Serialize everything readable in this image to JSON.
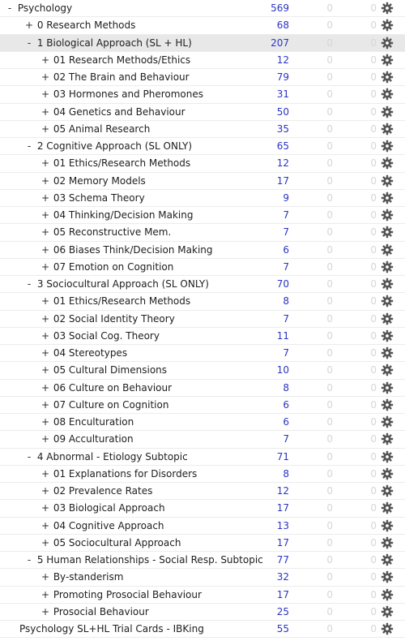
{
  "colors": {
    "new_count": "#2a35c4",
    "zero_count": "#d6d6d6",
    "current_row": "#e8e8e8",
    "gear": "#555555"
  },
  "icons": {
    "gear": "gear-icon"
  },
  "decks": [
    {
      "toggle": "-",
      "name": "Psychology",
      "new": "569",
      "learn": "0",
      "due": "0",
      "level": 0
    },
    {
      "toggle": "+",
      "name": "0 Research Methods",
      "new": "68",
      "learn": "0",
      "due": "0",
      "level": 1
    },
    {
      "toggle": "-",
      "name": "1 Biological Approach (SL + HL)",
      "new": "207",
      "learn": "0",
      "due": "0",
      "level": 1,
      "current": true
    },
    {
      "toggle": "+",
      "name": "01 Research Methods/Ethics",
      "new": "12",
      "learn": "0",
      "due": "0",
      "level": 2
    },
    {
      "toggle": "+",
      "name": "02 The Brain and Behaviour",
      "new": "79",
      "learn": "0",
      "due": "0",
      "level": 2
    },
    {
      "toggle": "+",
      "name": "03 Hormones and Pheromones",
      "new": "31",
      "learn": "0",
      "due": "0",
      "level": 2
    },
    {
      "toggle": "+",
      "name": "04 Genetics and Behaviour",
      "new": "50",
      "learn": "0",
      "due": "0",
      "level": 2
    },
    {
      "toggle": "+",
      "name": "05 Animal Research",
      "new": "35",
      "learn": "0",
      "due": "0",
      "level": 2
    },
    {
      "toggle": "-",
      "name": "2 Cognitive Approach (SL ONLY)",
      "new": "65",
      "learn": "0",
      "due": "0",
      "level": 1
    },
    {
      "toggle": "+",
      "name": "01 Ethics/Research Methods",
      "new": "12",
      "learn": "0",
      "due": "0",
      "level": 2
    },
    {
      "toggle": "+",
      "name": "02 Memory Models",
      "new": "17",
      "learn": "0",
      "due": "0",
      "level": 2
    },
    {
      "toggle": "+",
      "name": "03 Schema Theory",
      "new": "9",
      "learn": "0",
      "due": "0",
      "level": 2
    },
    {
      "toggle": "+",
      "name": "04 Thinking/Decision Making",
      "new": "7",
      "learn": "0",
      "due": "0",
      "level": 2
    },
    {
      "toggle": "+",
      "name": "05 Reconstructive Mem.",
      "new": "7",
      "learn": "0",
      "due": "0",
      "level": 2
    },
    {
      "toggle": "+",
      "name": "06 Biases Think/Decision Making",
      "new": "6",
      "learn": "0",
      "due": "0",
      "level": 2
    },
    {
      "toggle": "+",
      "name": "07 Emotion on Cognition",
      "new": "7",
      "learn": "0",
      "due": "0",
      "level": 2
    },
    {
      "toggle": "-",
      "name": "3 Sociocultural Approach (SL ONLY)",
      "new": "70",
      "learn": "0",
      "due": "0",
      "level": 1
    },
    {
      "toggle": "+",
      "name": "01 Ethics/Research Methods",
      "new": "8",
      "learn": "0",
      "due": "0",
      "level": 2
    },
    {
      "toggle": "+",
      "name": "02 Social Identity Theory",
      "new": "7",
      "learn": "0",
      "due": "0",
      "level": 2
    },
    {
      "toggle": "+",
      "name": "03 Social Cog. Theory",
      "new": "11",
      "learn": "0",
      "due": "0",
      "level": 2
    },
    {
      "toggle": "+",
      "name": "04 Stereotypes",
      "new": "7",
      "learn": "0",
      "due": "0",
      "level": 2
    },
    {
      "toggle": "+",
      "name": "05 Cultural Dimensions",
      "new": "10",
      "learn": "0",
      "due": "0",
      "level": 2
    },
    {
      "toggle": "+",
      "name": "06 Culture on Behaviour",
      "new": "8",
      "learn": "0",
      "due": "0",
      "level": 2
    },
    {
      "toggle": "+",
      "name": "07 Culture on Cognition",
      "new": "6",
      "learn": "0",
      "due": "0",
      "level": 2
    },
    {
      "toggle": "+",
      "name": "08 Enculturation",
      "new": "6",
      "learn": "0",
      "due": "0",
      "level": 2
    },
    {
      "toggle": "+",
      "name": "09 Acculturation",
      "new": "7",
      "learn": "0",
      "due": "0",
      "level": 2
    },
    {
      "toggle": "-",
      "name": "4 Abnormal - Etiology Subtopic",
      "new": "71",
      "learn": "0",
      "due": "0",
      "level": 1
    },
    {
      "toggle": "+",
      "name": "01 Explanations for Disorders",
      "new": "8",
      "learn": "0",
      "due": "0",
      "level": 2
    },
    {
      "toggle": "+",
      "name": "02 Prevalence Rates",
      "new": "12",
      "learn": "0",
      "due": "0",
      "level": 2
    },
    {
      "toggle": "+",
      "name": "03 Biological Approach",
      "new": "17",
      "learn": "0",
      "due": "0",
      "level": 2
    },
    {
      "toggle": "+",
      "name": "04 Cognitive Approach",
      "new": "13",
      "learn": "0",
      "due": "0",
      "level": 2
    },
    {
      "toggle": "+",
      "name": "05 Sociocultural Approach",
      "new": "17",
      "learn": "0",
      "due": "0",
      "level": 2
    },
    {
      "toggle": "-",
      "name": "5 Human Relationships - Social Resp. Subtopic",
      "new": "77",
      "learn": "0",
      "due": "0",
      "level": 1
    },
    {
      "toggle": "+",
      "name": "By-standerism",
      "new": "32",
      "learn": "0",
      "due": "0",
      "level": 2
    },
    {
      "toggle": "+",
      "name": "Promoting Prosocial Behaviour",
      "new": "17",
      "learn": "0",
      "due": "0",
      "level": 2
    },
    {
      "toggle": "+",
      "name": "Prosocial Behaviour",
      "new": "25",
      "learn": "0",
      "due": "0",
      "level": 2
    },
    {
      "toggle": "",
      "name": "Psychology SL+HL Trial Cards - IBKing",
      "new": "55",
      "learn": "0",
      "due": "0",
      "level": 0
    }
  ]
}
